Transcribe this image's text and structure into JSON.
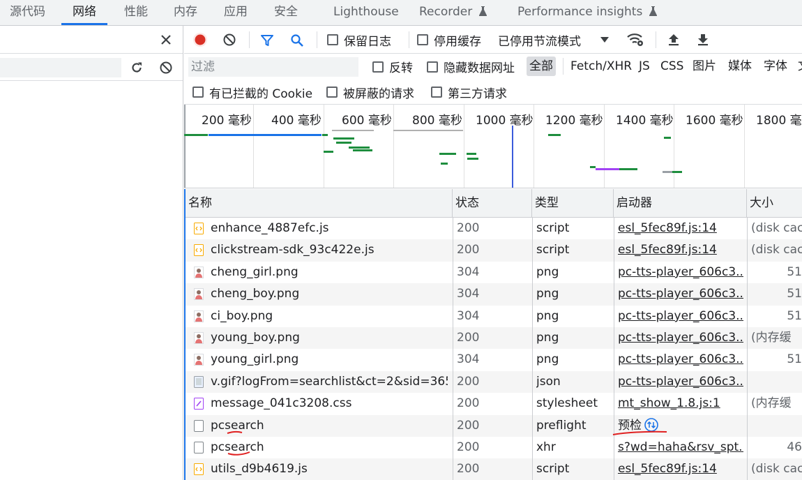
{
  "tabs": [
    {
      "label": "源代码"
    },
    {
      "label": "网络",
      "active": true
    },
    {
      "label": "性能"
    },
    {
      "label": "内存"
    },
    {
      "label": "应用"
    },
    {
      "label": "安全"
    },
    {
      "label": "Lighthouse"
    },
    {
      "label": "Recorder",
      "flask": true
    },
    {
      "label": "Performance insights",
      "flask": true
    }
  ],
  "toolbar": {
    "preserve_log": "保留日志",
    "disable_cache": "停用缓存",
    "throttling": "已停用节流模式"
  },
  "filterbar": {
    "placeholder": "过滤",
    "invert": "反转",
    "hide_data_urls": "隐藏数据网址",
    "types": [
      "全部",
      "Fetch/XHR",
      "JS",
      "CSS",
      "图片",
      "媒体",
      "字体",
      "文"
    ]
  },
  "checkbar": {
    "blocked_cookies": "有已拦截的 Cookie",
    "blocked_requests": "被屏蔽的请求",
    "third_party": "第三方请求"
  },
  "overview": {
    "ticks": [
      "200 毫秒",
      "400 毫秒",
      "600 毫秒",
      "800 毫秒",
      "1000 毫秒",
      "1200 毫秒",
      "1400 毫秒",
      "1600 毫秒",
      "1800 毫秒"
    ]
  },
  "table": {
    "headers": [
      "名称",
      "状态",
      "类型",
      "启动器",
      "大小"
    ],
    "rows": [
      {
        "name": "enhance_4887efc.js",
        "status": "200",
        "type": "script",
        "initiator": "esl_5fec89f.js:14",
        "size": "(disk cac",
        "icon": "script"
      },
      {
        "name": "clickstream-sdk_93c422e.js",
        "status": "200",
        "type": "script",
        "initiator": "esl_5fec89f.js:14",
        "size": "(disk cac",
        "icon": "script"
      },
      {
        "name": "cheng_girl.png",
        "status": "304",
        "type": "png",
        "initiator": "pc-tts-player_606c3...",
        "size": "51",
        "icon": "image"
      },
      {
        "name": "cheng_boy.png",
        "status": "304",
        "type": "png",
        "initiator": "pc-tts-player_606c3...",
        "size": "51",
        "icon": "image"
      },
      {
        "name": "ci_boy.png",
        "status": "304",
        "type": "png",
        "initiator": "pc-tts-player_606c3...",
        "size": "51",
        "icon": "image"
      },
      {
        "name": "young_boy.png",
        "status": "200",
        "type": "png",
        "initiator": "pc-tts-player_606c3...",
        "size": "(内存缓",
        "icon": "image"
      },
      {
        "name": "young_girl.png",
        "status": "304",
        "type": "png",
        "initiator": "pc-tts-player_606c3...",
        "size": "51",
        "icon": "image"
      },
      {
        "name": "v.gif?logFrom=searchlist&ct=2&sid=365...",
        "status": "200",
        "type": "json",
        "initiator": "pc-tts-player_606c3...",
        "size": "",
        "icon": "gif"
      },
      {
        "name": "message_041c3208.css",
        "status": "200",
        "type": "stylesheet",
        "initiator": "mt_show_1.8.js:1",
        "size": "(内存缓",
        "icon": "css"
      },
      {
        "name": "pcsearch",
        "status": "200",
        "type": "preflight",
        "initiator": "预检",
        "size": "",
        "icon": "doc",
        "preflight": true
      },
      {
        "name": "pcsearch",
        "status": "200",
        "type": "xhr",
        "initiator": "s?wd=haha&rsv_spt...",
        "size": "46",
        "icon": "doc"
      },
      {
        "name": "utils_d9b4619.js",
        "status": "200",
        "type": "script",
        "initiator": "esl_5fec89f.js:14",
        "size": "(disk cac",
        "icon": "script"
      }
    ]
  }
}
